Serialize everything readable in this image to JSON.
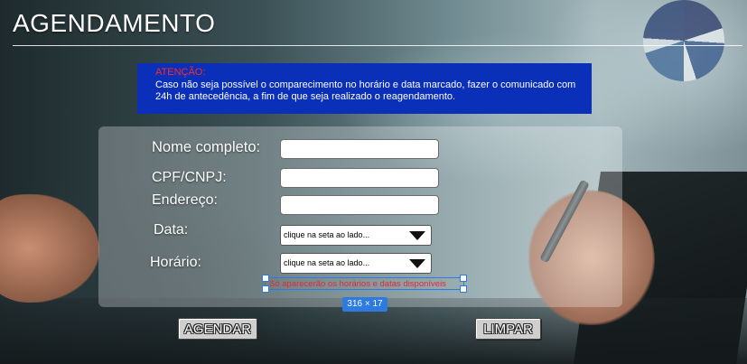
{
  "header": {
    "title": "AGENDAMENTO"
  },
  "notice": {
    "heading": "ATENÇÃO:",
    "text": "Caso não seja possível o comparecimento no horário e data marcado, fazer o comunicado com 24h de antecedência, a fim de que seja realizado o reagendamento."
  },
  "form": {
    "name_label": "Nome completo:",
    "name_value": "",
    "cpf_label": "CPF/CNPJ:",
    "cpf_value": "",
    "address_label": "Endereço:",
    "address_value": "",
    "date_label": "Data:",
    "date_selected": "clique na seta ao lado...",
    "time_label": "Horário:",
    "time_selected": "clique na seta ao lado...",
    "hint": "Só aparecerão os horários e datas disponíveis",
    "selection_size": "316 × 17"
  },
  "actions": {
    "schedule_label": "AGENDAR",
    "clear_label": "LIMPAR"
  },
  "colors": {
    "notice_bg": "#0a2fb9",
    "notice_heading": "#ff2a2a",
    "hint_text": "#e0293a",
    "selection_accent": "#2d7be0"
  }
}
